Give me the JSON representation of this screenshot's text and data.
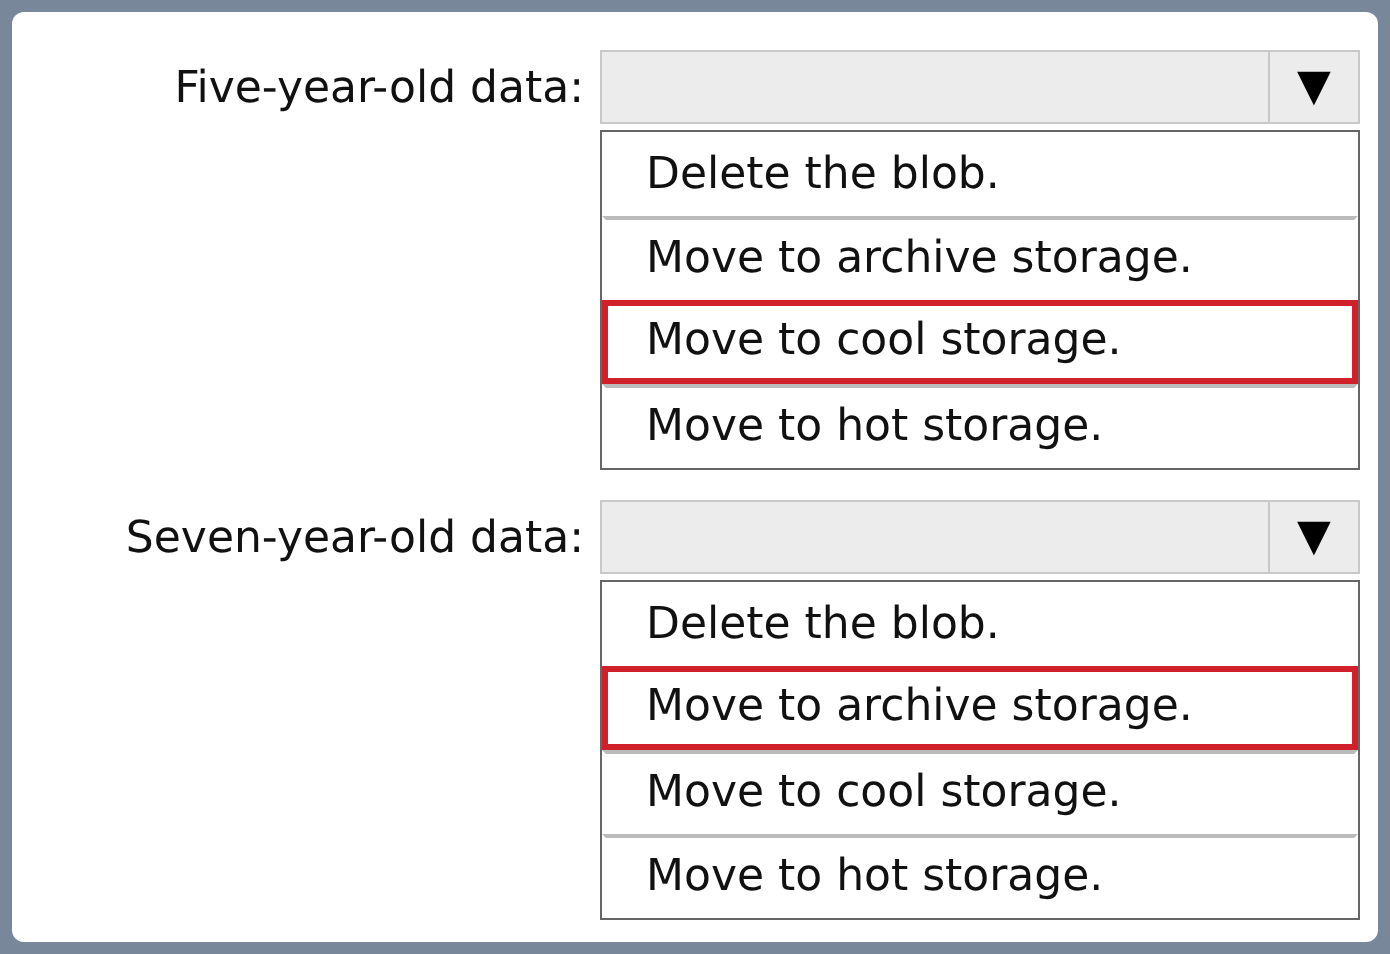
{
  "questions": [
    {
      "label": "Five-year-old data:",
      "arrow": "▼",
      "options": [
        {
          "text": "Delete the blob.",
          "selected": false
        },
        {
          "text": "Move to archive storage.",
          "selected": false
        },
        {
          "text": "Move to cool storage.",
          "selected": true
        },
        {
          "text": "Move to hot storage.",
          "selected": false
        }
      ]
    },
    {
      "label": "Seven-year-old data:",
      "arrow": "▼",
      "options": [
        {
          "text": "Delete the blob.",
          "selected": false
        },
        {
          "text": "Move to archive storage.",
          "selected": true
        },
        {
          "text": "Move to cool storage.",
          "selected": false
        },
        {
          "text": "Move to hot storage.",
          "selected": false
        }
      ]
    }
  ]
}
